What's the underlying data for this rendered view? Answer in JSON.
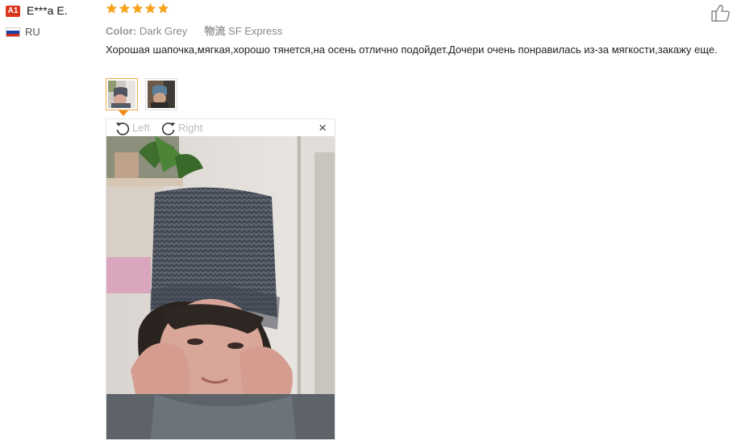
{
  "reviewer": {
    "badge": "A1",
    "name": "E***a E.",
    "country": "RU"
  },
  "rating": {
    "stars": 5,
    "max": 5,
    "color": "#f7a21b"
  },
  "meta": {
    "color_label": "Color:",
    "color_value": "Dark Grey",
    "shipping_label": "物流",
    "shipping_value": "SF Express"
  },
  "review_text": "Хорошая шапочка,мягкая,хорошо тянется,на осень отлично подойдет.Дочери очень понравилась из-за мягкости,закажу еще.",
  "viewer": {
    "rotate_left": "Left",
    "rotate_right": "Right",
    "close": "×"
  },
  "colors": {
    "accent": "#f28a18",
    "badge": "#d8371b"
  },
  "icons": [
    "like-icon",
    "rotate-left-icon",
    "rotate-right-icon",
    "close-icon",
    "star-icon"
  ]
}
